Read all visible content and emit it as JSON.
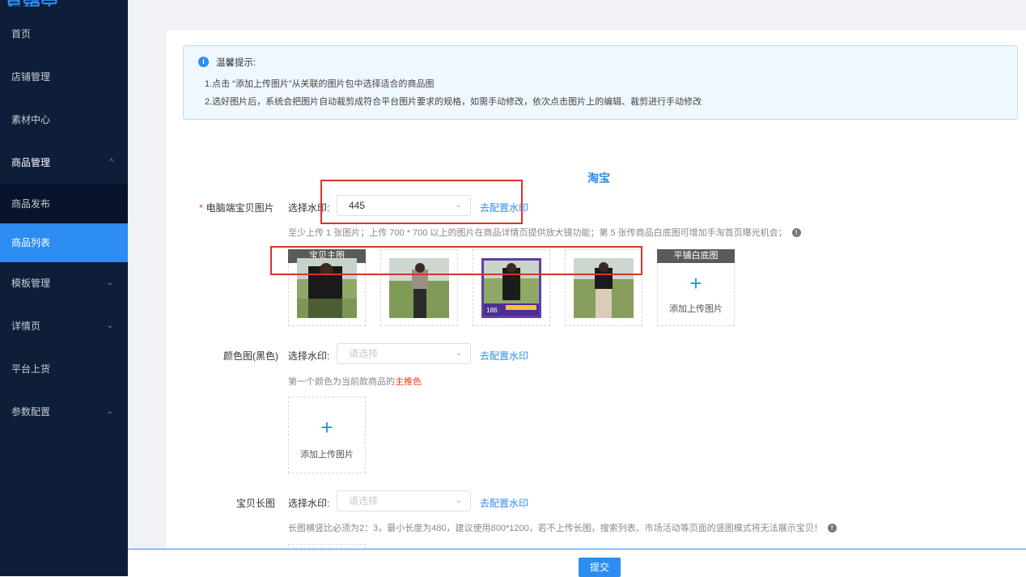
{
  "sidebar": {
    "logo": "易销宝",
    "items": [
      {
        "label": "首页"
      },
      {
        "label": "店铺管理"
      },
      {
        "label": "素材中心"
      },
      {
        "label": "商品管理",
        "chevron": "^"
      },
      {
        "label": "商品发布"
      },
      {
        "label": "商品列表"
      },
      {
        "label": "模板管理",
        "chevron": "⌄"
      },
      {
        "label": "详情页",
        "chevron": "⌄"
      },
      {
        "label": "平台上货"
      },
      {
        "label": "参数配置",
        "chevron": "⌄"
      }
    ]
  },
  "notice": {
    "title": "温馨提示:",
    "line1": "1.点击 “添加上传图片”从关联的图片包中选择适合的商品图",
    "line2": "2.选好图片后，系统会把图片自动裁剪成符合平台图片要求的规格，如需手动修改，依次点击图片上的编辑、裁剪进行手动修改"
  },
  "platform_title": "淘宝",
  "pc_images": {
    "label": "电脑端宝贝图片",
    "required": "*",
    "watermark_label": "选择水印:",
    "watermark_value": "445",
    "config_link": "去配置水印",
    "hint": "至少上传 1 张图片；上传 700 * 700 以上的图片在商品详情页提供放大镜功能；第 5 张传商品白底图可增加手淘首页曝光机会；",
    "main_tag": "宝贝主图",
    "white_tag": "平铺白底图",
    "upload_text": "添加上传图片",
    "badge_price": "188."
  },
  "color_images": {
    "label": "颜色图(黑色)",
    "watermark_label": "选择水印:",
    "placeholder": "请选择",
    "config_link": "去配置水印",
    "hint_prefix": "第一个颜色为当前款商品的",
    "hint_accent": "主推色",
    "upload_text": "添加上传图片"
  },
  "long_images": {
    "label": "宝贝长图",
    "watermark_label": "选择水印:",
    "placeholder": "请选择",
    "config_link": "去配置水印",
    "hint": "长图横竖比必须为2：3，最小长度为480，建议使用800*1200，若不上传长图，搜索列表、市场活动等页面的竖图模式将无法展示宝贝！"
  },
  "footer": {
    "submit": "提交"
  },
  "colors": {
    "accent": "#2d8cf0",
    "sidebar_bg": "#0e1e39",
    "highlight": "#d9342b"
  }
}
